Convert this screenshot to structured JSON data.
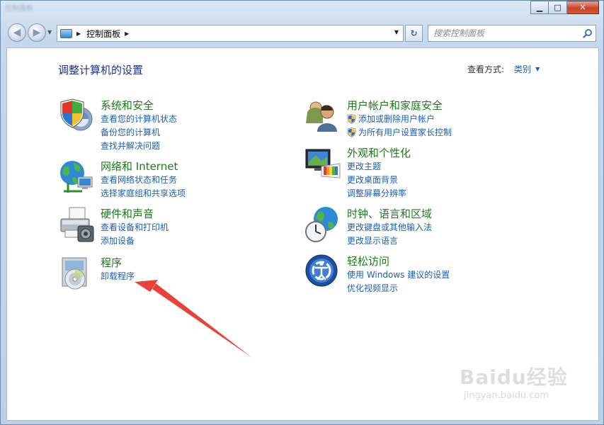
{
  "titlebar": {
    "blurred_title": "控制面板"
  },
  "navbar": {
    "address_path": "控制面板",
    "search_placeholder": "搜索控制面板"
  },
  "header": {
    "title": "调整计算机的设置",
    "view_by_label": "查看方式:",
    "view_by_value": "类别"
  },
  "categories_left": [
    {
      "title": "系统和安全",
      "icon": "security-shield-icon",
      "links": [
        "查看您的计算机状态",
        "备份您的计算机",
        "查找并解决问题"
      ]
    },
    {
      "title": "网络和 Internet",
      "icon": "network-globe-icon",
      "links": [
        "查看网络状态和任务",
        "选择家庭组和共享选项"
      ]
    },
    {
      "title": "硬件和声音",
      "icon": "printer-icon",
      "links": [
        "查看设备和打印机",
        "添加设备"
      ]
    },
    {
      "title": "程序",
      "icon": "programs-disc-icon",
      "links": [
        "卸载程序"
      ]
    }
  ],
  "categories_right": [
    {
      "title": "用户帐户和家庭安全",
      "icon": "users-icon",
      "links": [
        "添加或删除用户帐户",
        "为所有用户设置家长控制"
      ]
    },
    {
      "title": "外观和个性化",
      "icon": "monitor-palette-icon",
      "links": [
        "更改主题",
        "更改桌面背景",
        "调整屏幕分辨率"
      ]
    },
    {
      "title": "时钟、语言和区域",
      "icon": "clock-globe-icon",
      "links": [
        "更改键盘或其他输入法",
        "更改显示语言"
      ]
    },
    {
      "title": "轻松访问",
      "icon": "ease-of-access-icon",
      "links": [
        "使用 Windows 建议的设置",
        "优化视频显示"
      ]
    }
  ],
  "watermark": {
    "main": "Baidu经验",
    "sub": "jingyan.baidu.com"
  },
  "colors": {
    "category_title": "#1f7a1f",
    "link": "#1c5fb4",
    "page_title": "#1e3287",
    "annotation_arrow": "#e8433a"
  }
}
